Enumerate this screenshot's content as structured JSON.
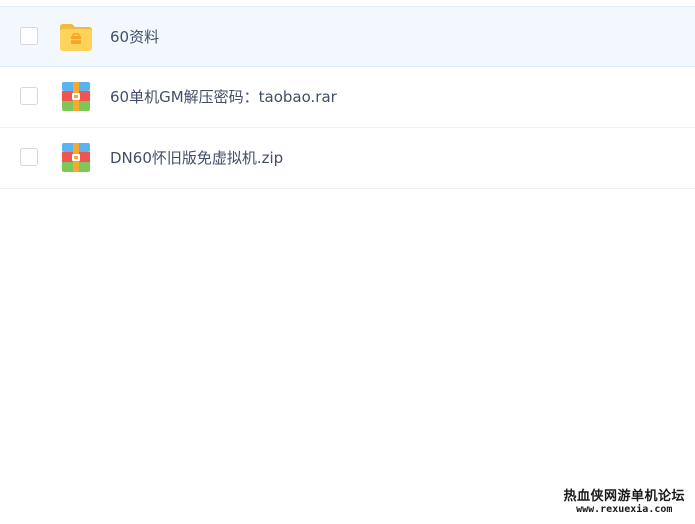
{
  "files": [
    {
      "name": "60资料",
      "type": "folder",
      "selected": true
    },
    {
      "name": "60单机GM解压密码：taobao.rar",
      "type": "archive",
      "selected": false
    },
    {
      "name": "DN60怀旧版免虚拟机.zip",
      "type": "archive",
      "selected": false
    }
  ],
  "watermark": {
    "title": "热血侠网游单机论坛",
    "url": "www.rexuexia.com"
  },
  "colors": {
    "selected_row_bg": "#f2f8fe",
    "text": "#424e67",
    "folder_yellow": "#ffd25a",
    "archive_blue": "#5ab3f0",
    "archive_red": "#f0544f",
    "archive_green": "#7cc758",
    "archive_orange": "#f7a830"
  }
}
